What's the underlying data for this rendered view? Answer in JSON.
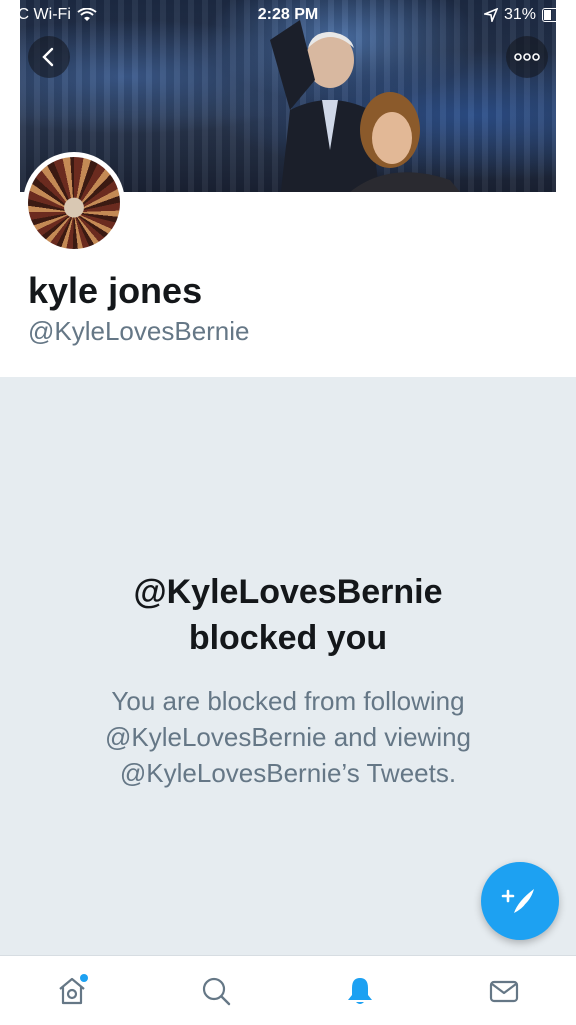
{
  "status_bar": {
    "carrier": "CC Wi-Fi",
    "time": "2:28 PM",
    "battery": "31%"
  },
  "profile": {
    "name": "kyle jones",
    "handle": "@KyleLovesBernie"
  },
  "blocked": {
    "title_line1": "@KyleLovesBernie",
    "title_line2": "blocked you",
    "desc_line1": "You are blocked from following",
    "desc_line2": "@KyleLovesBernie and viewing",
    "desc_line3": "@KyleLovesBernie’s Tweets."
  },
  "tabs": [
    {
      "icon": "home-icon",
      "active": false,
      "has_dot": true
    },
    {
      "icon": "search-icon",
      "active": false
    },
    {
      "icon": "notifications-bell-icon",
      "active": true
    },
    {
      "icon": "messages-envelope-icon",
      "active": false
    }
  ],
  "colors": {
    "accent": "#1da1f2",
    "name": "#14171a",
    "secondary": "#657786",
    "blocked_bg": "#e6ecf0"
  },
  "icons": {
    "back": "chevron-left-icon",
    "more": "more-dots-icon",
    "compose": "compose-tweet-icon"
  }
}
